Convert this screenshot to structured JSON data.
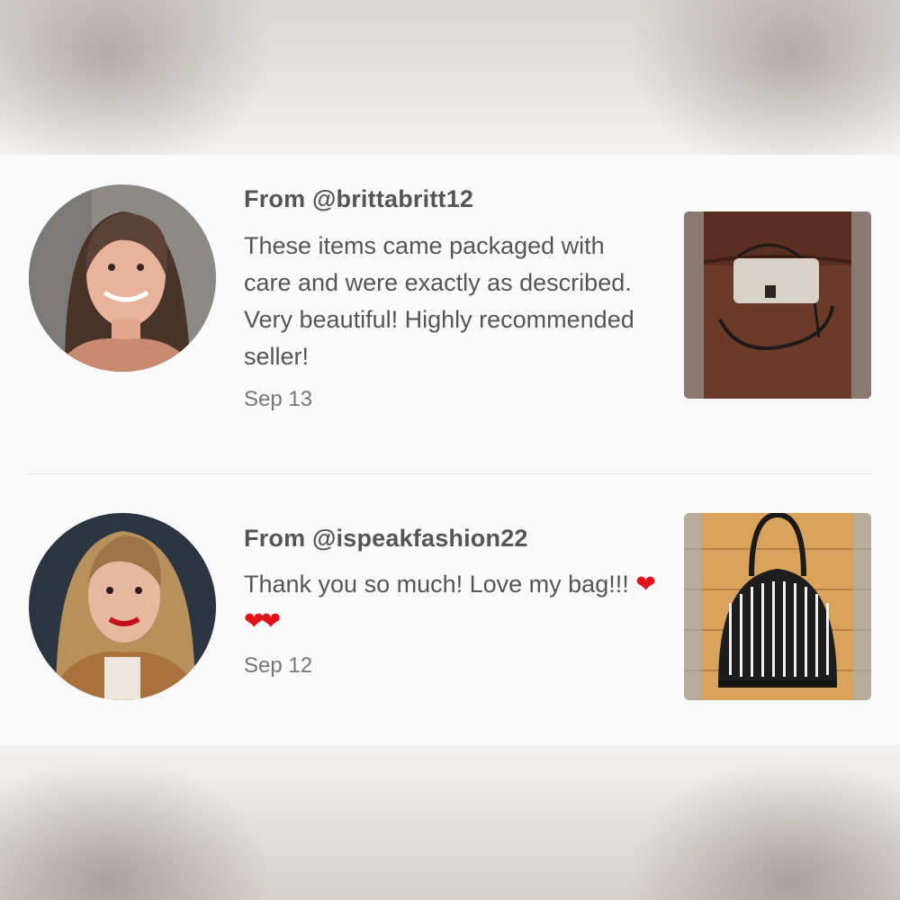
{
  "reviews": [
    {
      "from": "From @brittabritt12",
      "text": "These items came packaged with care and were exactly as described. Very beautiful! Highly recommended seller!",
      "date": "Sep 13"
    },
    {
      "from": "From @ispeakfashion22",
      "text": "Thank you so much! Love my bag!!!",
      "emoji": "❤❤❤",
      "date": "Sep 12"
    }
  ],
  "colors": {
    "text": "#555555",
    "date": "#777777",
    "heart": "#e3121b",
    "panel": "#fafafa"
  }
}
